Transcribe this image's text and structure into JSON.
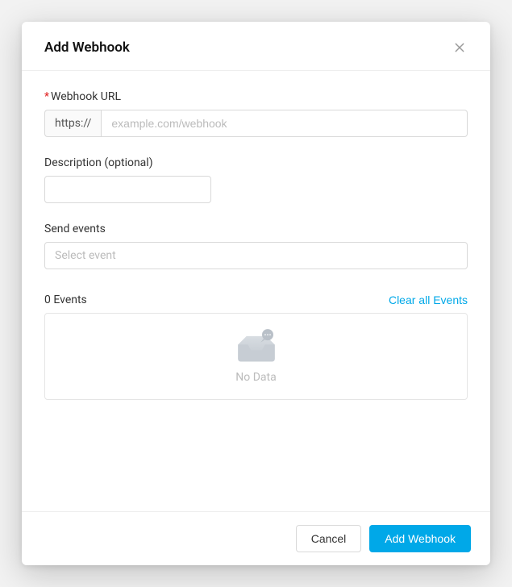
{
  "modal": {
    "title": "Add Webhook"
  },
  "fields": {
    "url": {
      "label": "Webhook URL",
      "prefix": "https://",
      "placeholder": "example.com/webhook",
      "value": ""
    },
    "description": {
      "label": "Description (optional)",
      "value": ""
    },
    "events": {
      "label": "Send events",
      "placeholder": "Select event"
    }
  },
  "events": {
    "count_label": "0 Events",
    "clear_label": "Clear all Events",
    "empty_text": "No Data"
  },
  "footer": {
    "cancel": "Cancel",
    "submit": "Add Webhook"
  }
}
